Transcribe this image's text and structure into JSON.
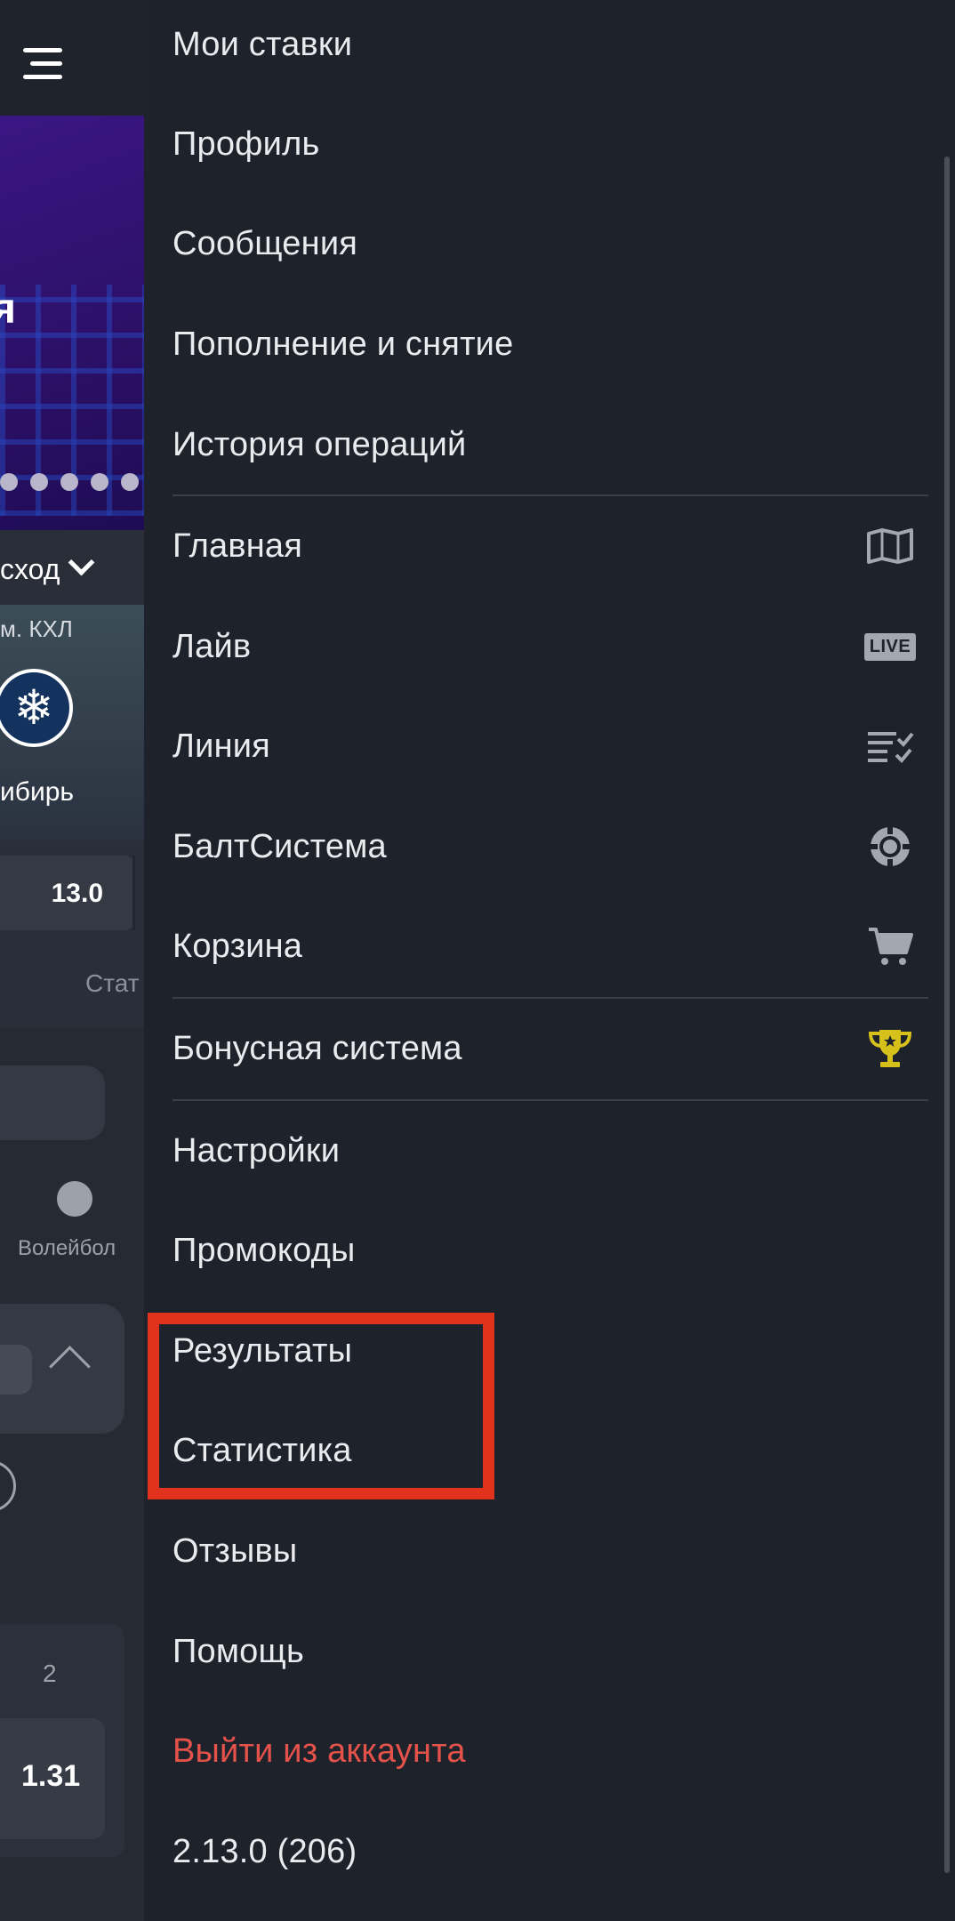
{
  "background": {
    "banner_text": "я",
    "outcome_label": "сход",
    "league": "м.   КХЛ",
    "team_name": "ибирь",
    "odd_value": "13.0",
    "stats_label": "Стат",
    "sport_label": "Волейбол",
    "odds_column": "2",
    "odds_value": "1.31"
  },
  "menu": {
    "items": [
      {
        "label": "Мои ставки",
        "icon": ""
      },
      {
        "label": "Профиль",
        "icon": ""
      },
      {
        "label": "Сообщения",
        "icon": ""
      },
      {
        "label": "Пополнение и снятие",
        "icon": ""
      },
      {
        "label": "История операций",
        "icon": ""
      },
      {
        "label": "Главная",
        "icon": "map-icon"
      },
      {
        "label": "Лайв",
        "icon": "live-icon",
        "badge": "LIVE"
      },
      {
        "label": "Линия",
        "icon": "checklist-icon"
      },
      {
        "label": "БалтСистема",
        "icon": "chip-icon"
      },
      {
        "label": "Корзина",
        "icon": "cart-icon"
      },
      {
        "label": "Бонусная система",
        "icon": "trophy-icon"
      },
      {
        "label": "Настройки",
        "icon": ""
      },
      {
        "label": "Промокоды",
        "icon": ""
      },
      {
        "label": "Результаты",
        "icon": ""
      },
      {
        "label": "Статистика",
        "icon": ""
      },
      {
        "label": "Отзывы",
        "icon": ""
      },
      {
        "label": "Помощь",
        "icon": ""
      },
      {
        "label": "Выйти из аккаунта",
        "icon": ""
      }
    ],
    "version": "2.13.0 (206)"
  },
  "colors": {
    "drawer_bg": "#1e222b",
    "text": "#e9ebef",
    "logout": "#e4524a",
    "highlight": "#e0321d",
    "trophy": "#d6c11a",
    "icon": "#a2a7b0"
  }
}
